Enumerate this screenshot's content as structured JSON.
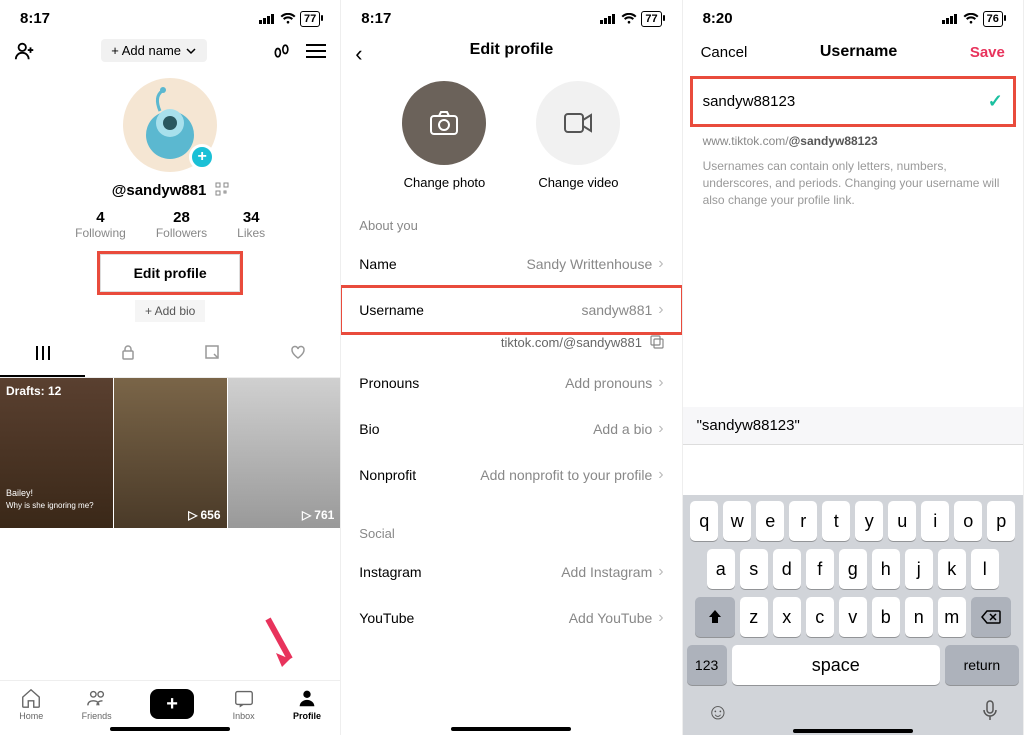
{
  "screen1": {
    "time": "8:17",
    "battery": "77",
    "add_name": "+ Add name",
    "handle": "@sandyw881",
    "stats": {
      "following_num": "4",
      "following_lbl": "Following",
      "followers_num": "28",
      "followers_lbl": "Followers",
      "likes_num": "34",
      "likes_lbl": "Likes"
    },
    "edit_profile": "Edit profile",
    "add_bio": "+ Add bio",
    "drafts": "Drafts: 12",
    "views1": "656",
    "views2": "761",
    "thumb_caption1": "Bailey!",
    "thumb_caption2": "Why is she ignoring me?",
    "nav": {
      "home": "Home",
      "friends": "Friends",
      "inbox": "Inbox",
      "profile": "Profile"
    }
  },
  "screen2": {
    "time": "8:17",
    "battery": "77",
    "title": "Edit profile",
    "change_photo": "Change photo",
    "change_video": "Change video",
    "about_you": "About you",
    "name_lbl": "Name",
    "name_val": "Sandy Writtenhouse",
    "username_lbl": "Username",
    "username_val": "sandyw881",
    "profile_link": "tiktok.com/@sandyw881",
    "pronouns_lbl": "Pronouns",
    "pronouns_val": "Add pronouns",
    "bio_lbl": "Bio",
    "bio_val": "Add a bio",
    "nonprofit_lbl": "Nonprofit",
    "nonprofit_val": "Add nonprofit to your profile",
    "social": "Social",
    "instagram_lbl": "Instagram",
    "instagram_val": "Add Instagram",
    "youtube_lbl": "YouTube",
    "youtube_val": "Add YouTube"
  },
  "screen3": {
    "time": "8:20",
    "battery": "76",
    "cancel": "Cancel",
    "title": "Username",
    "save": "Save",
    "input_val": "sandyw88123",
    "url_prefix": "www.tiktok.com/",
    "url_handle": "@sandyw88123",
    "help": "Usernames can contain only letters, numbers, underscores, and periods. Changing your username will also change your profile link.",
    "suggestion": "\"sandyw88123\"",
    "keys_row1": [
      "q",
      "w",
      "e",
      "r",
      "t",
      "y",
      "u",
      "i",
      "o",
      "p"
    ],
    "keys_row2": [
      "a",
      "s",
      "d",
      "f",
      "g",
      "h",
      "j",
      "k",
      "l"
    ],
    "keys_row3": [
      "z",
      "x",
      "c",
      "v",
      "b",
      "n",
      "m"
    ],
    "num_key": "123",
    "space": "space",
    "return": "return"
  }
}
